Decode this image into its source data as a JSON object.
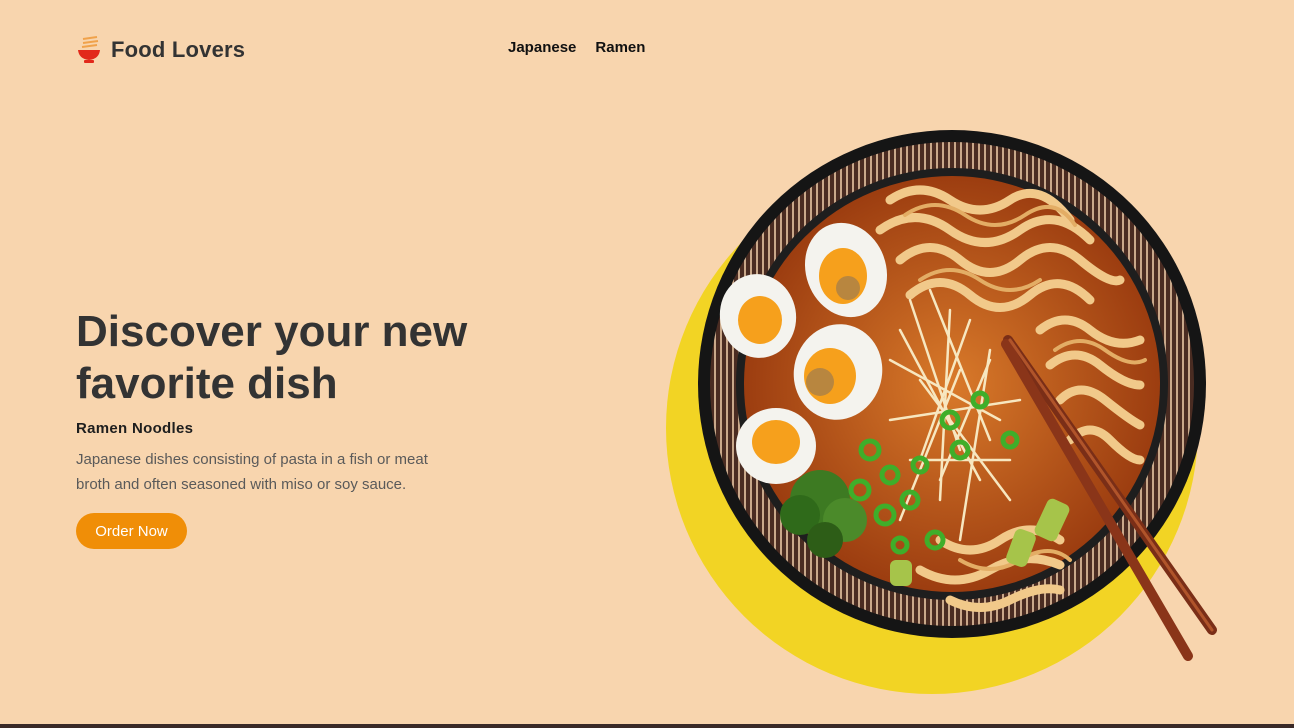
{
  "brand": {
    "name": "Food Lovers",
    "icon": "ramen-bowl-icon"
  },
  "nav": {
    "items": [
      "Japanese",
      "Ramen"
    ]
  },
  "hero": {
    "title": "Discover your new favorite dish",
    "subtitle": "Ramen Noodles",
    "description": "Japanese dishes consisting of pasta in a fish or meat broth and often seasoned with miso or soy sauce.",
    "cta": "Order Now"
  },
  "image": {
    "subject": "ramen bowl with eggs, noodles, green onions and chopsticks"
  },
  "colors": {
    "background": "#f8d5ae",
    "accent": "#f08e07",
    "circle": "#f2d424",
    "text": "#333333",
    "broth": "#c0581a",
    "bowl": "#1b1b1b"
  }
}
